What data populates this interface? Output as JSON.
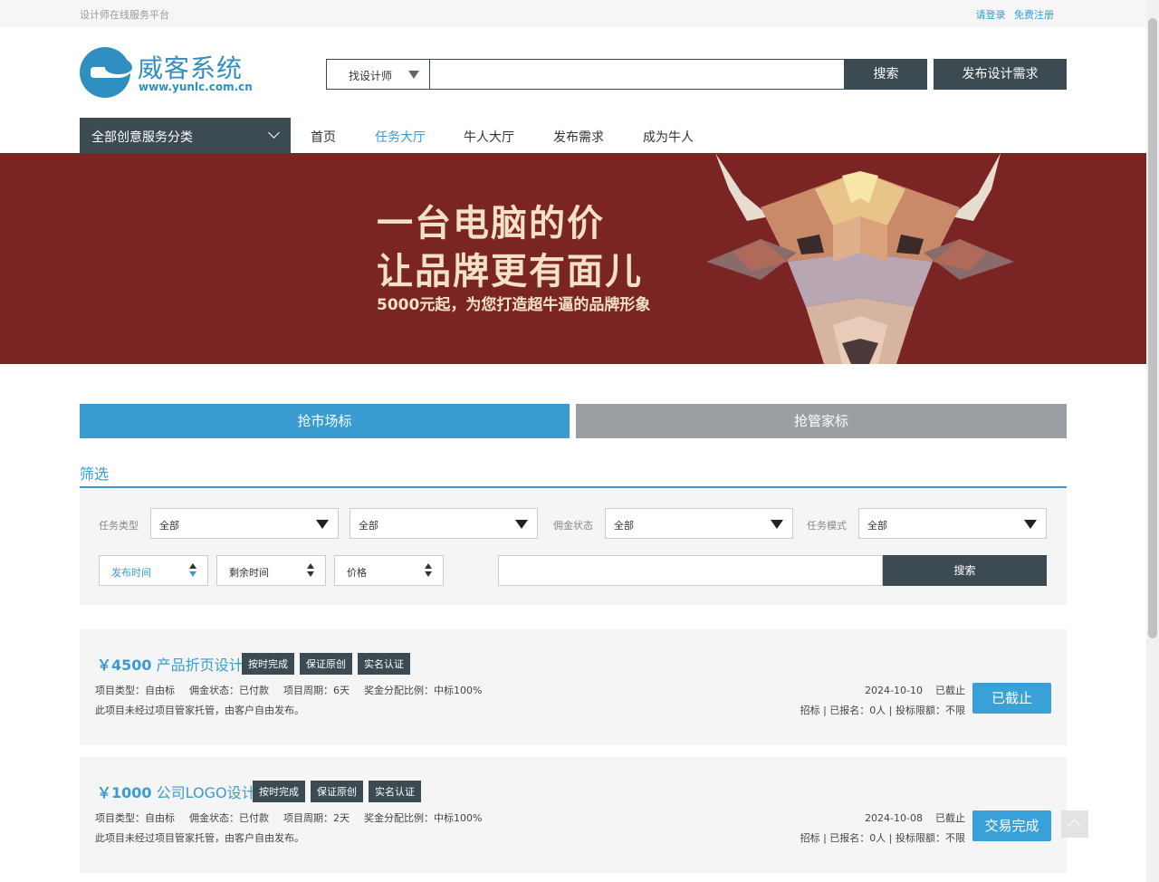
{
  "topbar": {
    "slogan": "设计师在线服务平台",
    "login": "请登录",
    "register": "免费注册"
  },
  "logo": {
    "name": "威客系统",
    "url": "www.yunlc.com.cn"
  },
  "search": {
    "type_selected": "找设计师",
    "placeholder": "",
    "button": "搜索",
    "publish_button": "发布设计需求"
  },
  "nav": {
    "category_label": "全部创意服务分类",
    "items": [
      {
        "label": "首页",
        "active": false
      },
      {
        "label": "任务大厅",
        "active": true
      },
      {
        "label": "牛人大厅",
        "active": false
      },
      {
        "label": "发布需求",
        "active": false
      },
      {
        "label": "成为牛人",
        "active": false
      }
    ]
  },
  "banner": {
    "line1": "一台电脑的价",
    "line2": "让品牌更有面儿",
    "subtitle": "5000元起，为您打造超牛逼的品牌形象"
  },
  "tabs": [
    {
      "label": "抢市场标"
    },
    {
      "label": "抢管家标"
    }
  ],
  "filter": {
    "title": "筛选",
    "task_type_label": "任务类型",
    "task_type_value": "全部",
    "sub_type_value": "全部",
    "commission_label": "佣金状态",
    "commission_value": "全部",
    "mode_label": "任务模式",
    "mode_value": "全部",
    "sort": [
      {
        "label": "发布时间"
      },
      {
        "label": "剩余时间"
      },
      {
        "label": "价格"
      }
    ],
    "search_button": "搜索"
  },
  "tasks": [
    {
      "price": "￥4500",
      "name": "产品折页设计",
      "tags": [
        "按时完成",
        "保证原创",
        "实名认证"
      ],
      "meta": [
        "项目类型：自由标",
        "佣金状态：已付款",
        "项目周期：6天",
        "奖金分配比例：中标100%"
      ],
      "desc": "此项目未经过项目管家托管，由客户自由发布。",
      "date": "2024-10-10",
      "status_text": "已截止",
      "stats": "招标 | 已报名：0人 | 投标限额：不限",
      "button": "已截止"
    },
    {
      "price": "￥1000",
      "name": "公司LOGO设计",
      "tags": [
        "按时完成",
        "保证原创",
        "实名认证"
      ],
      "meta": [
        "项目类型：自由标",
        "佣金状态：已付款",
        "项目周期：2天",
        "奖金分配比例：中标100%"
      ],
      "desc": "此项目未经过项目管家托管，由客户自由发布。",
      "date": "2024-10-08",
      "status_text": "已截止",
      "stats": "招标 | 已报名：0人 | 投标限额：不限",
      "button": "交易完成"
    }
  ],
  "colors": {
    "accent": "#3a9bd0",
    "dark": "#3c4a52",
    "banner": "#7a2424",
    "tab_inactive": "#999fa3"
  }
}
